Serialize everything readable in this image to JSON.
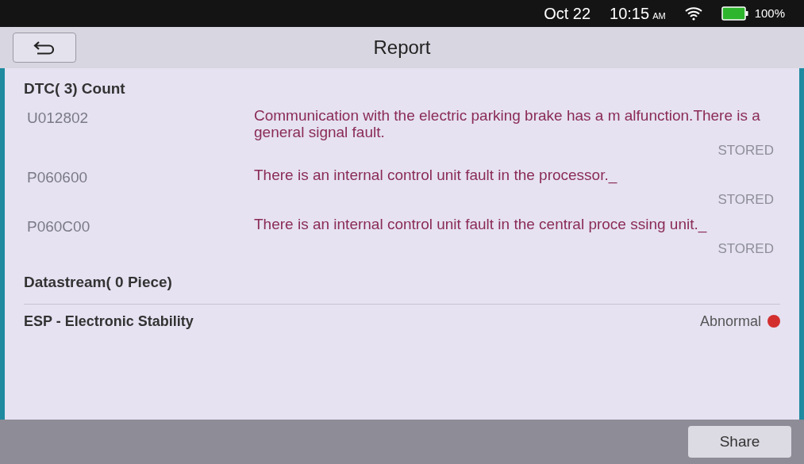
{
  "status_bar": {
    "date": "Oct 22",
    "time": "10:15",
    "meridiem": "AM",
    "battery": "100%"
  },
  "title_bar": {
    "title": "Report"
  },
  "dtc_section": {
    "heading": "DTC( 3) Count",
    "rows": [
      {
        "code": "U012802",
        "description": "Communication with the electric parking brake has a m alfunction.There is a general signal fault.",
        "status": "STORED"
      },
      {
        "code": "P060600",
        "description": "There is an internal control unit fault in the processor._",
        "status": "STORED"
      },
      {
        "code": "P060C00",
        "description": "There is an internal control unit fault in the central proce ssing unit._",
        "status": "STORED"
      }
    ]
  },
  "datastream_section": {
    "heading": "Datastream( 0 Piece)"
  },
  "systems": [
    {
      "name": "ESP - Electronic Stability",
      "status": "Abnormal",
      "color": "#d32f2f"
    }
  ],
  "bottom_bar": {
    "buttons": [
      "Share"
    ]
  }
}
